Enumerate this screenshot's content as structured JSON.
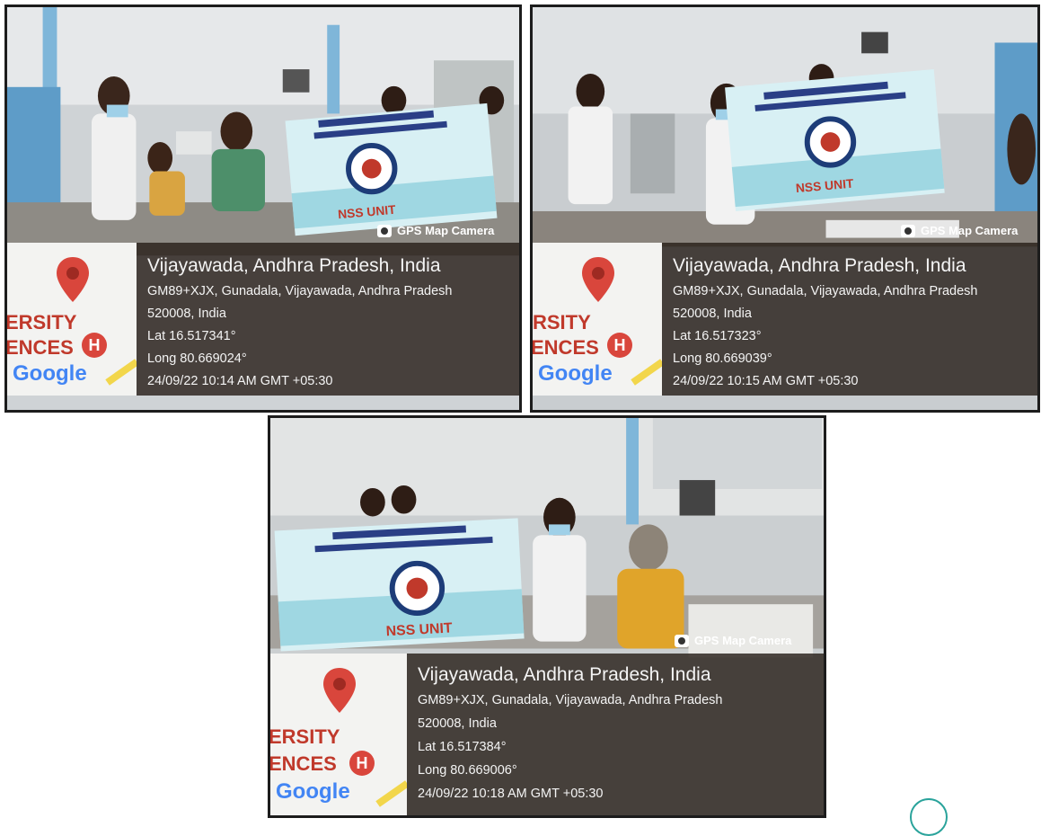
{
  "photos": [
    {
      "id": "photo-1",
      "gps_label": "GPS Map Camera",
      "map_text_1": "ERSITY",
      "map_text_2": "ENCES",
      "map_badge": "H",
      "google_logo": "Google",
      "location_title": "Vijayawada, Andhra Pradesh, India",
      "address_line": "GM89+XJX, Gunadala, Vijayawada, Andhra Pradesh",
      "postal_line": "520008, India",
      "lat": "Lat 16.517341°",
      "long": "Long 80.669024°",
      "timestamp": "24/09/22 10:14 AM GMT +05:30"
    },
    {
      "id": "photo-2",
      "gps_label": "GPS Map Camera",
      "map_text_1": "RSITY",
      "map_text_2": "ENCES",
      "map_badge": "H",
      "google_logo": "Google",
      "location_title": "Vijayawada, Andhra Pradesh, India",
      "address_line": "GM89+XJX, Gunadala, Vijayawada, Andhra Pradesh",
      "postal_line": "520008, India",
      "lat": "Lat 16.517323°",
      "long": "Long 80.669039°",
      "timestamp": "24/09/22 10:15 AM GMT +05:30"
    },
    {
      "id": "photo-3",
      "gps_label": "GPS Map Camera",
      "map_text_1": "ERSITY",
      "map_text_2": "ENCES",
      "map_badge": "H",
      "google_logo": "Google",
      "location_title": "Vijayawada, Andhra Pradesh, India",
      "address_line": "GM89+XJX, Gunadala, Vijayawada, Andhra Pradesh",
      "postal_line": "520008, India",
      "lat": "Lat 16.517384°",
      "long": "Long 80.669006°",
      "timestamp": "24/09/22 10:18 AM GMT +05:30"
    }
  ],
  "banner_text": "NSS UNIT",
  "colors": {
    "map_pin": "#d9463c",
    "info_overlay": "#28201a",
    "banner": "#d8f0f4",
    "accent_teal": "#2aa39b"
  }
}
